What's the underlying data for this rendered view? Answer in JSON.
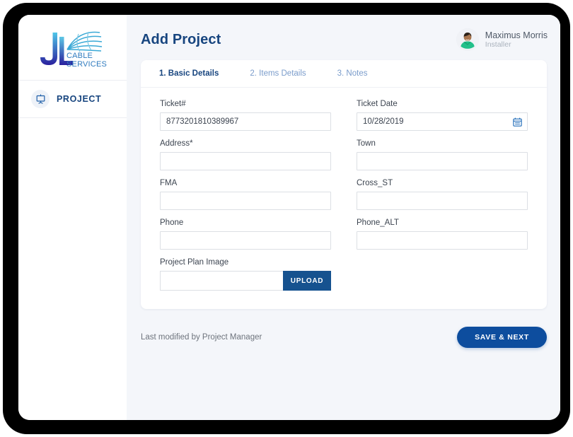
{
  "app": {
    "logo_text_line1": "CABLE",
    "logo_text_line2": "SERVICES",
    "logo_letters": "JL"
  },
  "sidebar": {
    "items": [
      {
        "label": "PROJECT",
        "icon": "presentation-board-icon"
      }
    ]
  },
  "header": {
    "title": "Add Project",
    "user": {
      "name": "Maximus Morris",
      "role": "Installer",
      "avatar_alt": "user-avatar"
    }
  },
  "tabs": [
    {
      "label": "1. Basic Details",
      "active": true
    },
    {
      "label": "2. Items Details",
      "active": false
    },
    {
      "label": "3. Notes",
      "active": false
    }
  ],
  "form": {
    "fields": [
      {
        "label": "Ticket#",
        "value": "8773201810389967",
        "placeholder": ""
      },
      {
        "label": "Ticket Date",
        "value": "10/28/2019",
        "placeholder": "",
        "icon": "calendar-icon"
      },
      {
        "label": "Address*",
        "value": "",
        "placeholder": ""
      },
      {
        "label": "Town",
        "value": "",
        "placeholder": ""
      },
      {
        "label": "FMA",
        "value": "",
        "placeholder": ""
      },
      {
        "label": "Cross_ST",
        "value": "",
        "placeholder": ""
      },
      {
        "label": "Phone",
        "value": "",
        "placeholder": ""
      },
      {
        "label": "Phone_ALT",
        "value": "",
        "placeholder": ""
      }
    ],
    "upload": {
      "label": "Project Plan Image",
      "value": "",
      "placeholder": "",
      "button_label": "UPLOAD"
    }
  },
  "footer": {
    "last_modified": "Last modified by Project Manager",
    "save_label": "SAVE & NEXT"
  },
  "colors": {
    "brand_blue": "#17457f",
    "accent_blue": "#0d4d9e",
    "upload_blue": "#16528f",
    "tab_inactive": "#7a9ccb",
    "page_bg": "#f4f6fa"
  }
}
